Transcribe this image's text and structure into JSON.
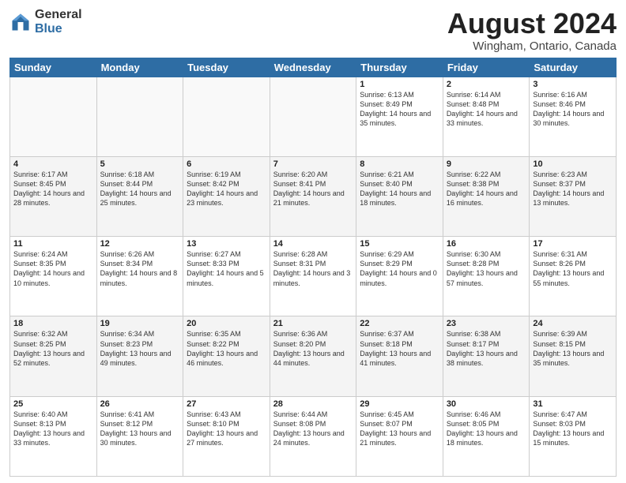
{
  "header": {
    "logo_general": "General",
    "logo_blue": "Blue",
    "main_title": "August 2024",
    "subtitle": "Wingham, Ontario, Canada"
  },
  "calendar": {
    "days_of_week": [
      "Sunday",
      "Monday",
      "Tuesday",
      "Wednesday",
      "Thursday",
      "Friday",
      "Saturday"
    ],
    "weeks": [
      [
        {
          "day": "",
          "info": "",
          "empty": true
        },
        {
          "day": "",
          "info": "",
          "empty": true
        },
        {
          "day": "",
          "info": "",
          "empty": true
        },
        {
          "day": "",
          "info": "",
          "empty": true
        },
        {
          "day": "1",
          "info": "Sunrise: 6:13 AM\nSunset: 8:49 PM\nDaylight: 14 hours\nand 35 minutes."
        },
        {
          "day": "2",
          "info": "Sunrise: 6:14 AM\nSunset: 8:48 PM\nDaylight: 14 hours\nand 33 minutes."
        },
        {
          "day": "3",
          "info": "Sunrise: 6:16 AM\nSunset: 8:46 PM\nDaylight: 14 hours\nand 30 minutes."
        }
      ],
      [
        {
          "day": "4",
          "info": "Sunrise: 6:17 AM\nSunset: 8:45 PM\nDaylight: 14 hours\nand 28 minutes."
        },
        {
          "day": "5",
          "info": "Sunrise: 6:18 AM\nSunset: 8:44 PM\nDaylight: 14 hours\nand 25 minutes."
        },
        {
          "day": "6",
          "info": "Sunrise: 6:19 AM\nSunset: 8:42 PM\nDaylight: 14 hours\nand 23 minutes."
        },
        {
          "day": "7",
          "info": "Sunrise: 6:20 AM\nSunset: 8:41 PM\nDaylight: 14 hours\nand 21 minutes."
        },
        {
          "day": "8",
          "info": "Sunrise: 6:21 AM\nSunset: 8:40 PM\nDaylight: 14 hours\nand 18 minutes."
        },
        {
          "day": "9",
          "info": "Sunrise: 6:22 AM\nSunset: 8:38 PM\nDaylight: 14 hours\nand 16 minutes."
        },
        {
          "day": "10",
          "info": "Sunrise: 6:23 AM\nSunset: 8:37 PM\nDaylight: 14 hours\nand 13 minutes."
        }
      ],
      [
        {
          "day": "11",
          "info": "Sunrise: 6:24 AM\nSunset: 8:35 PM\nDaylight: 14 hours\nand 10 minutes."
        },
        {
          "day": "12",
          "info": "Sunrise: 6:26 AM\nSunset: 8:34 PM\nDaylight: 14 hours\nand 8 minutes."
        },
        {
          "day": "13",
          "info": "Sunrise: 6:27 AM\nSunset: 8:33 PM\nDaylight: 14 hours\nand 5 minutes."
        },
        {
          "day": "14",
          "info": "Sunrise: 6:28 AM\nSunset: 8:31 PM\nDaylight: 14 hours\nand 3 minutes."
        },
        {
          "day": "15",
          "info": "Sunrise: 6:29 AM\nSunset: 8:29 PM\nDaylight: 14 hours\nand 0 minutes."
        },
        {
          "day": "16",
          "info": "Sunrise: 6:30 AM\nSunset: 8:28 PM\nDaylight: 13 hours\nand 57 minutes."
        },
        {
          "day": "17",
          "info": "Sunrise: 6:31 AM\nSunset: 8:26 PM\nDaylight: 13 hours\nand 55 minutes."
        }
      ],
      [
        {
          "day": "18",
          "info": "Sunrise: 6:32 AM\nSunset: 8:25 PM\nDaylight: 13 hours\nand 52 minutes."
        },
        {
          "day": "19",
          "info": "Sunrise: 6:34 AM\nSunset: 8:23 PM\nDaylight: 13 hours\nand 49 minutes."
        },
        {
          "day": "20",
          "info": "Sunrise: 6:35 AM\nSunset: 8:22 PM\nDaylight: 13 hours\nand 46 minutes."
        },
        {
          "day": "21",
          "info": "Sunrise: 6:36 AM\nSunset: 8:20 PM\nDaylight: 13 hours\nand 44 minutes."
        },
        {
          "day": "22",
          "info": "Sunrise: 6:37 AM\nSunset: 8:18 PM\nDaylight: 13 hours\nand 41 minutes."
        },
        {
          "day": "23",
          "info": "Sunrise: 6:38 AM\nSunset: 8:17 PM\nDaylight: 13 hours\nand 38 minutes."
        },
        {
          "day": "24",
          "info": "Sunrise: 6:39 AM\nSunset: 8:15 PM\nDaylight: 13 hours\nand 35 minutes."
        }
      ],
      [
        {
          "day": "25",
          "info": "Sunrise: 6:40 AM\nSunset: 8:13 PM\nDaylight: 13 hours\nand 33 minutes."
        },
        {
          "day": "26",
          "info": "Sunrise: 6:41 AM\nSunset: 8:12 PM\nDaylight: 13 hours\nand 30 minutes."
        },
        {
          "day": "27",
          "info": "Sunrise: 6:43 AM\nSunset: 8:10 PM\nDaylight: 13 hours\nand 27 minutes."
        },
        {
          "day": "28",
          "info": "Sunrise: 6:44 AM\nSunset: 8:08 PM\nDaylight: 13 hours\nand 24 minutes."
        },
        {
          "day": "29",
          "info": "Sunrise: 6:45 AM\nSunset: 8:07 PM\nDaylight: 13 hours\nand 21 minutes."
        },
        {
          "day": "30",
          "info": "Sunrise: 6:46 AM\nSunset: 8:05 PM\nDaylight: 13 hours\nand 18 minutes."
        },
        {
          "day": "31",
          "info": "Sunrise: 6:47 AM\nSunset: 8:03 PM\nDaylight: 13 hours\nand 15 minutes."
        }
      ]
    ]
  }
}
